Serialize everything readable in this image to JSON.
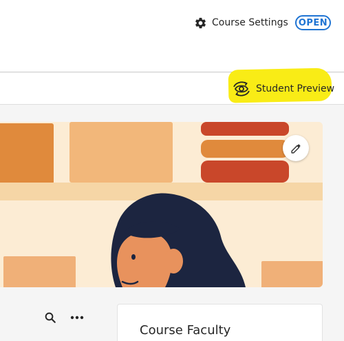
{
  "header": {
    "settings_icon": "gear-icon",
    "settings_label": "Course Settings",
    "status_label": "OPEN",
    "status_color": "#1f74d3"
  },
  "preview": {
    "icon": "eye-refresh-icon",
    "label": "Student Preview",
    "highlight_color": "#f9ec16"
  },
  "banner": {
    "illustration": "person-at-bookshelf",
    "edit_icon": "pencil-icon"
  },
  "toolbar": {
    "search_icon": "search-icon",
    "more_icon": "more-horizontal-icon"
  },
  "faculty_card": {
    "title": "Course Faculty"
  }
}
